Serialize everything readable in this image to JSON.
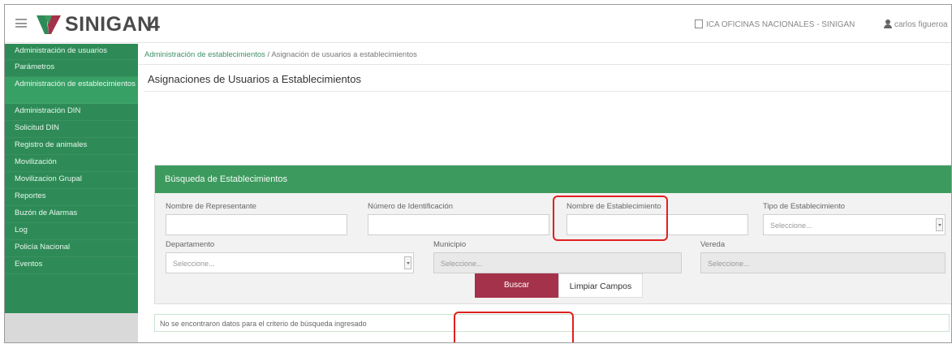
{
  "header": {
    "app_name": "SINIGAN",
    "app_version": "4",
    "organization": "ICA OFICINAS NACIONALES - SINIGAN",
    "user": "carlos figueroa"
  },
  "sidebar": {
    "items": [
      {
        "label": "Administración de usuarios"
      },
      {
        "label": "Parámetros"
      },
      {
        "label": "Administración de establecimientos"
      },
      {
        "label": "Administración DIN"
      },
      {
        "label": "Solicitud DIN"
      },
      {
        "label": "Registro de animales"
      },
      {
        "label": "Movilización"
      },
      {
        "label": "Movilizacion Grupal"
      },
      {
        "label": "Reportes"
      },
      {
        "label": "Buzón de Alarmas"
      },
      {
        "label": "Log"
      },
      {
        "label": "Policía Nacional"
      },
      {
        "label": "Eventos"
      }
    ]
  },
  "breadcrumb": {
    "link": "Administración de establecimientos",
    "separator": " / ",
    "current": "Asignación de usuarios a establecimientos"
  },
  "page": {
    "title": "Asignaciones de Usuarios a Establecimientos"
  },
  "search": {
    "panel_title": "Búsqueda de Establecimientos",
    "fields": {
      "representante": {
        "label": "Nombre de Representante",
        "value": ""
      },
      "identificacion": {
        "label": "Número de Identificación",
        "value": ""
      },
      "establecimiento": {
        "label": "Nombre de Establecimiento",
        "value": ""
      },
      "tipo": {
        "label": "Tipo de Establecimiento",
        "value": "Seleccione..."
      },
      "departamento": {
        "label": "Departamento",
        "value": "Seleccione..."
      },
      "municipio": {
        "label": "Municipio",
        "value": "Seleccione..."
      },
      "vereda": {
        "label": "Vereda",
        "value": "Seleccione..."
      }
    },
    "buttons": {
      "search": "Buscar",
      "clear": "Limpiar Campos"
    }
  },
  "results": {
    "message": "No se encontraron datos para el criterio de búsqueda ingresado"
  },
  "colors": {
    "sidebar": "#2e8b57",
    "panel_header": "#3d9a5e",
    "search_button": "#a4324a",
    "annotation": "#e02020"
  }
}
